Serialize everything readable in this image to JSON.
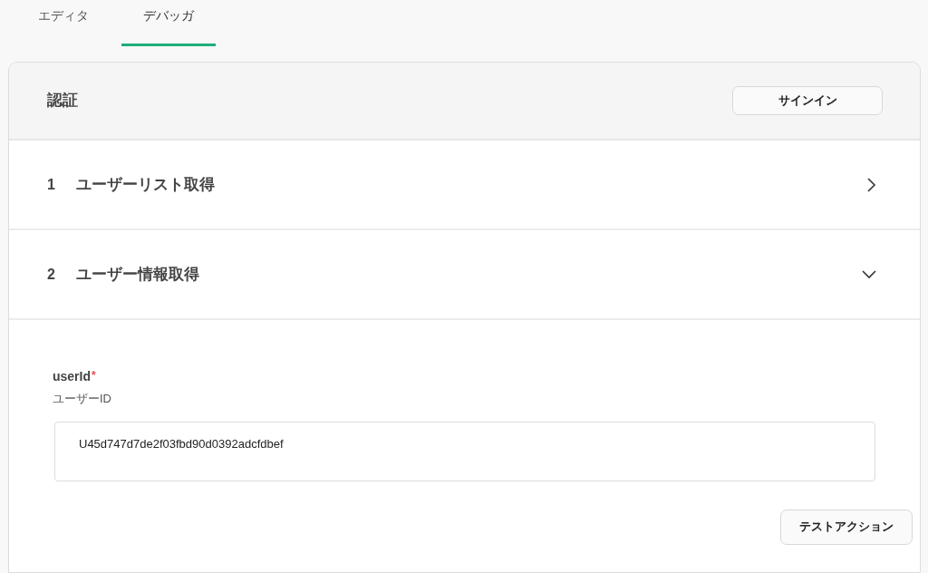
{
  "tabs": [
    {
      "label": "エディタ",
      "selected": false
    },
    {
      "label": "デバッガ",
      "selected": true
    }
  ],
  "auth": {
    "title": "認証",
    "button": "サインイン"
  },
  "steps": [
    {
      "number": "1",
      "title": "ユーザーリスト取得",
      "expanded": false
    },
    {
      "number": "2",
      "title": "ユーザー情報取得",
      "expanded": true,
      "fields": [
        {
          "name": "userId",
          "required_mark": "*",
          "description": "ユーザーID",
          "value": "U45d747d7de2f03fbd90d0392adcfdbef"
        }
      ],
      "action": "テストアクション"
    }
  ]
}
